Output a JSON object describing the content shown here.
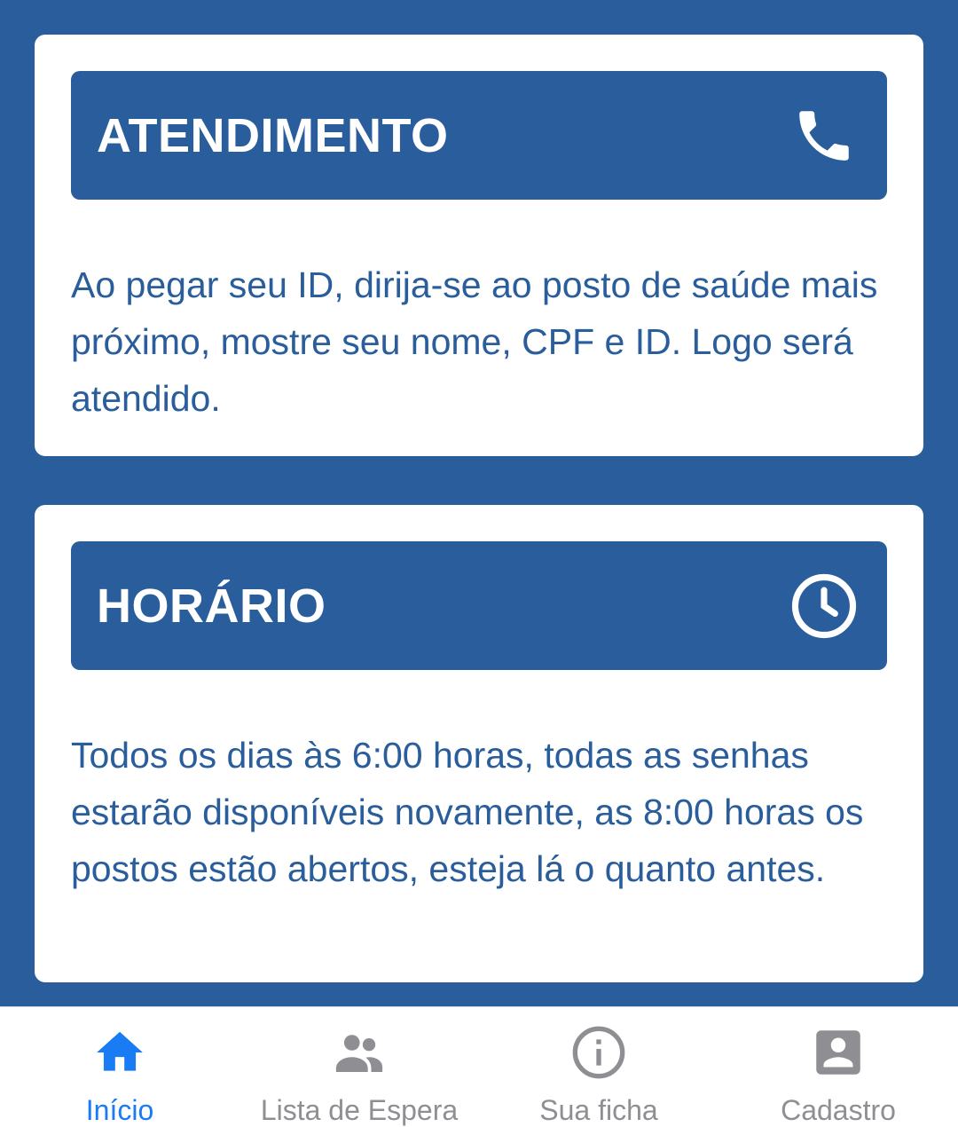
{
  "cards": [
    {
      "title": "ATENDIMENTO",
      "icon": "phone-icon",
      "body": "Ao pegar seu ID, dirija-se ao posto de saúde mais próximo, mostre seu nome, CPF e ID. Logo será atendido."
    },
    {
      "title": "HORÁRIO",
      "icon": "clock-icon",
      "body": "Todos os dias às 6:00 horas, todas as senhas estarão disponíveis novamente, as 8:00 horas os postos estão abertos, esteja lá o quanto antes."
    }
  ],
  "nav": {
    "active": "Início",
    "items": [
      {
        "label": "Início",
        "icon": "home-icon"
      },
      {
        "label": "Lista de Espera",
        "icon": "people-icon"
      },
      {
        "label": "Sua ficha",
        "icon": "info-icon"
      },
      {
        "label": "Cadastro",
        "icon": "account-box-icon"
      }
    ]
  },
  "colors": {
    "background": "#295d9b",
    "card": "#ffffff",
    "nav_active": "#1a7cf5",
    "nav_inactive": "#8e8e93"
  }
}
